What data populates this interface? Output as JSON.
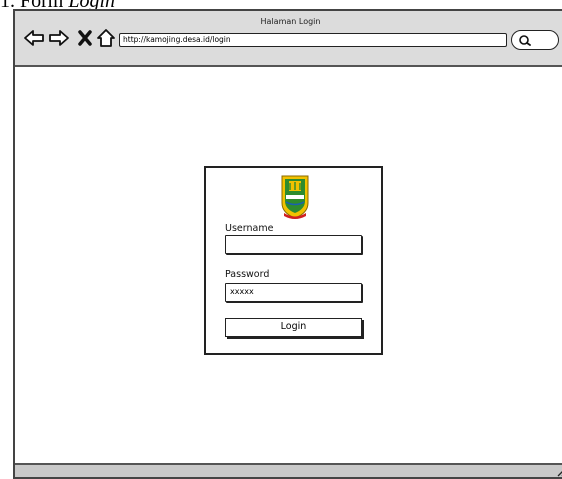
{
  "document": {
    "caption_prefix": "1.  Form ",
    "caption_italic": "Login"
  },
  "browser": {
    "page_title": "Halaman Login",
    "url": "http://kamojing.desa.id/login",
    "nav_icons": [
      "back-arrow-icon",
      "forward-arrow-icon",
      "stop-icon",
      "home-icon"
    ],
    "search_icon": "search-icon"
  },
  "login_form": {
    "logo_icon": "village-emblem-logo",
    "username_label": "Username",
    "username_value": "",
    "password_label": "Password",
    "password_value": "xxxxx",
    "submit_label": "Login"
  },
  "colors": {
    "toolbar": "#dcdcdc",
    "frame_border": "#444444",
    "emblem_green": "#2e8b2e",
    "emblem_yellow": "#f2c200",
    "emblem_red": "#d02020"
  }
}
